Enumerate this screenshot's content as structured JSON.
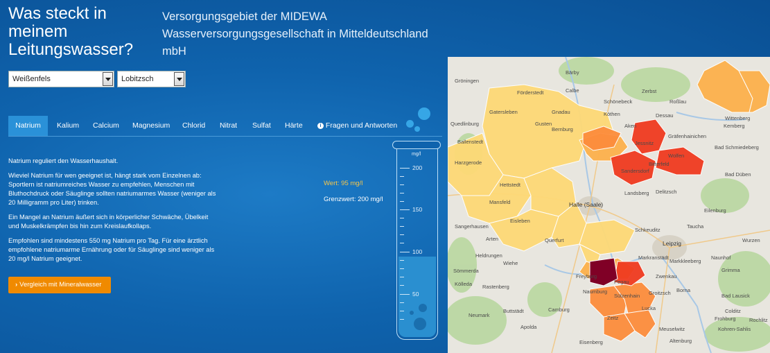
{
  "header": {
    "title": "Was steckt in meinem Leitungswasser?",
    "subtitle_line1": "Versorgungsgebiet der MIDEWA",
    "subtitle_line2": "Wasserversorgungsgesellschaft in Mitteldeutschland mbH"
  },
  "selects": {
    "region": "Weißenfels",
    "place": "Lobitzsch"
  },
  "tabs": [
    "Natrium",
    "Kalium",
    "Calcium",
    "Magnesium",
    "Chlorid",
    "Nitrat",
    "Sulfat",
    "Härte",
    "Fragen und Antworten"
  ],
  "active_tab": "Natrium",
  "content": {
    "p1": "Natrium reguliert den Wasserhaushalt.",
    "p2": "Wieviel Natrium für wen geeignet ist, hängt stark vom Einzelnen ab: Sportlern ist natriumreiches Wasser zu empfehlen, Menschen mit Bluthochdruck oder Säuglinge sollten natriumarmes Wasser (weniger als 20 Milligramm pro Liter) trinken.",
    "p3": "Ein Mangel an Natrium äußert sich in körperlicher Schwäche, Übelkeit und Muskelkrämpfen bis hin zum Kreislaufkollaps.",
    "p4": "Empfohlen sind mindestens 550 mg Natrium pro Tag. Für eine ärztlich empfohlene natriumarme Ernährung oder für Säuglinge sind weniger als 20 mg/l Natrium geeignet.",
    "button": "Vergleich mit Mineralwasser"
  },
  "values": {
    "wert": "Wert: 95 mg/l",
    "grenzwert": "Grenzwert: 200 mg/l",
    "fill_value_mg_l": 95
  },
  "gauge": {
    "unit": "mg/l",
    "labels": [
      "200",
      "150",
      "100",
      "50"
    ]
  },
  "map_labels": [
    "Bärby",
    "Gröningen",
    "Förderstedt",
    "Calbe",
    "Schönebeck",
    "Gnadau",
    "Zerbst",
    "Roßlau",
    "Wittenberg",
    "Dessau",
    "Aken",
    "Quedlinburg",
    "Gatersleben",
    "Gusten",
    "Köthen",
    "Gräfenhainichen",
    "Kemberg",
    "Bad Schmiedeberg",
    "Ballenstedt",
    "Harzgerode",
    "Bernburg",
    "Bitterfeld",
    "Wolfen",
    "Jessnitz",
    "Sandersdorf",
    "Bad Düben",
    "Landsberg",
    "Delitzsch",
    "Halle (Saale)",
    "Eilenburg",
    "Leipzig",
    "Taucha",
    "Schkeuditz",
    "Markranstädt",
    "Markkleeberg",
    "Naunhof",
    "Grimma",
    "Wurzen",
    "Pegau",
    "Zwenkau",
    "Borna",
    "Lucka",
    "Bad Lausick",
    "Colditz",
    "Groitzsch",
    "Naumburg",
    "Querfurt",
    "Freyburg",
    "Rastenberg",
    "Kölleda",
    "Sömmerda",
    "Buttstädt",
    "Camburg",
    "Apolda",
    "Zeitz",
    "Meuselwitz",
    "Altenburg",
    "Rochlitz",
    "Frohburg",
    "Kohren-Sahlis",
    "Eisenberg",
    "Neumark",
    "Wiehe",
    "Heldrungen",
    "Arten",
    "Eisleben",
    "Hettstedt",
    "Mansfeld",
    "Sangerhausen",
    "Sülzenhain"
  ]
}
